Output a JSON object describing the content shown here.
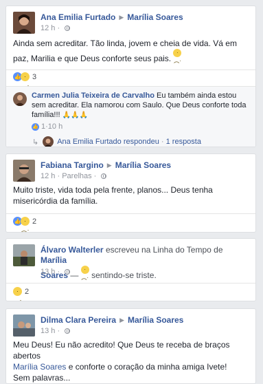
{
  "posts": [
    {
      "author": "Ana Emilia Furtado",
      "target": "Marília Soares",
      "time": "12 h",
      "text": "Ainda sem acreditar. Tão linda, jovem e cheia de vida. Vá em paz, Marilia e que Deus conforte seus pais.",
      "reaction_count": "3",
      "comment": {
        "author": "Carmen Julia Teixeira de Carvalho",
        "text": "Eu também ainda estou sem acreditar. Ela namorou com Saulo. Que Deus conforte toda família!!!",
        "prayer_emojis": "🙏🙏🙏",
        "meta_likes": "1",
        "meta_time": "10 h",
        "reply_author": "Ana Emilia Furtado",
        "reply_verb": "respondeu",
        "reply_count": "1 resposta"
      }
    },
    {
      "author": "Fabiana Targino",
      "target": "Marília Soares",
      "time": "12 h",
      "audience": "Parelhas",
      "text": "Muito triste, vida toda pela frente, planos... Deus tenha misericórdia da família.",
      "reaction_count": "2"
    },
    {
      "author": "Álvaro Walterler",
      "verb": "escreveu na Linha do Tempo de",
      "target_a": "Marília",
      "target_b": "Soares",
      "feeling": "sentindo-se triste.",
      "time": "13 h",
      "reaction_count": "2"
    },
    {
      "author": "Dilma Clara Pereira",
      "target": "Marília Soares",
      "time": "13 h",
      "text_line1": "Meu Deus! Eu não acredito! Que Deus te receba de braços abertos",
      "text_link": "Marília Soares",
      "text_line2_rest": "e conforte o coração da minha amiga Ivete!",
      "text_line3": "Sem palavras..."
    }
  ],
  "colors": {
    "link": "#365899",
    "background": "#e9ebee",
    "like": "#5890ff",
    "sad": "#f7d14a"
  },
  "icons": {
    "like": "thumbs-up-icon",
    "sad": "sad-face-icon",
    "globe": "globe-icon",
    "reply": "reply-arrow-icon"
  }
}
